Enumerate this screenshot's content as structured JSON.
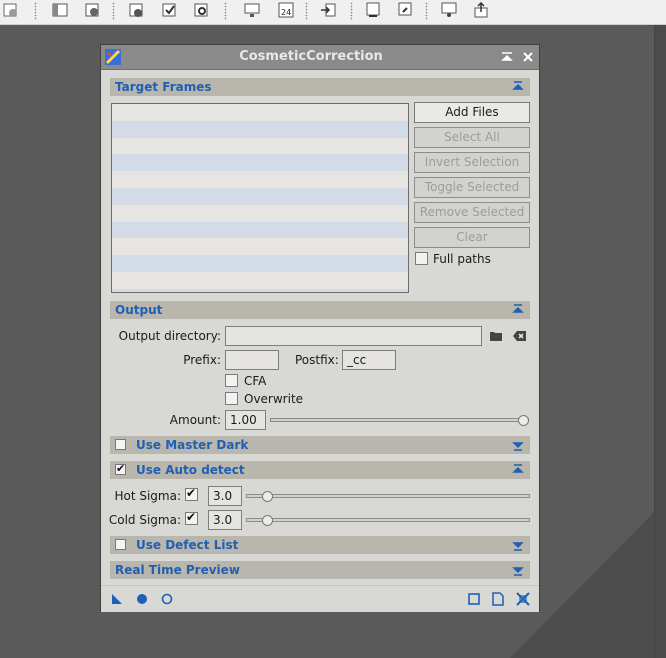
{
  "toolbar": {
    "icons": [
      "close-view-icon",
      "separator",
      "image-window-icon",
      "reset-icon",
      "separator",
      "new-instance-icon",
      "apply-icon",
      "preview-icon",
      "separator",
      "screen-icon",
      "frame-24-icon",
      "separator",
      "import-icon",
      "separator",
      "explore-icon",
      "capture-icon",
      "separator",
      "process-icon",
      "upload-icon"
    ]
  },
  "dialog": {
    "title": "CosmeticCorrection",
    "sections": {
      "target_frames": {
        "label": "Target Frames",
        "buttons": {
          "add_files": "Add Files",
          "select_all": "Select All",
          "invert_selection": "Invert Selection",
          "toggle_selected": "Toggle Selected",
          "remove_selected": "Remove Selected",
          "clear": "Clear"
        },
        "full_paths_label": "Full paths",
        "full_paths_checked": false
      },
      "output": {
        "label": "Output",
        "output_directory_label": "Output directory:",
        "output_directory_value": "",
        "prefix_label": "Prefix:",
        "prefix_value": "",
        "postfix_label": "Postfix:",
        "postfix_value": "_cc",
        "cfa_label": "CFA",
        "cfa_checked": false,
        "overwrite_label": "Overwrite",
        "overwrite_checked": false,
        "amount_label": "Amount:",
        "amount_value": "1.00",
        "amount_level": 1.0
      },
      "master_dark": {
        "label": "Use Master Dark",
        "checked": false
      },
      "auto_detect": {
        "label": "Use Auto detect",
        "checked": true,
        "hot_sigma_label": "Hot Sigma:",
        "hot_sigma_checked": true,
        "hot_sigma_value": "3.0",
        "cold_sigma_label": "Cold Sigma:",
        "cold_sigma_checked": true,
        "cold_sigma_value": "3.0"
      },
      "defect_list": {
        "label": "Use Defect List",
        "checked": false
      },
      "real_time_preview": {
        "label": "Real Time Preview"
      }
    },
    "bottom_icons": [
      "new-instance-triangle-icon",
      "apply-global-icon",
      "apply-icon",
      "preview-square-icon",
      "edit-document-icon",
      "reset-icon"
    ]
  },
  "colors": {
    "section_label": "#1f5fb5",
    "section_header": "#b9b6ae",
    "title_bar": "#8a8a8a",
    "list_alt_row": "#d3dbe6",
    "workspace": "#5a5a5a"
  }
}
